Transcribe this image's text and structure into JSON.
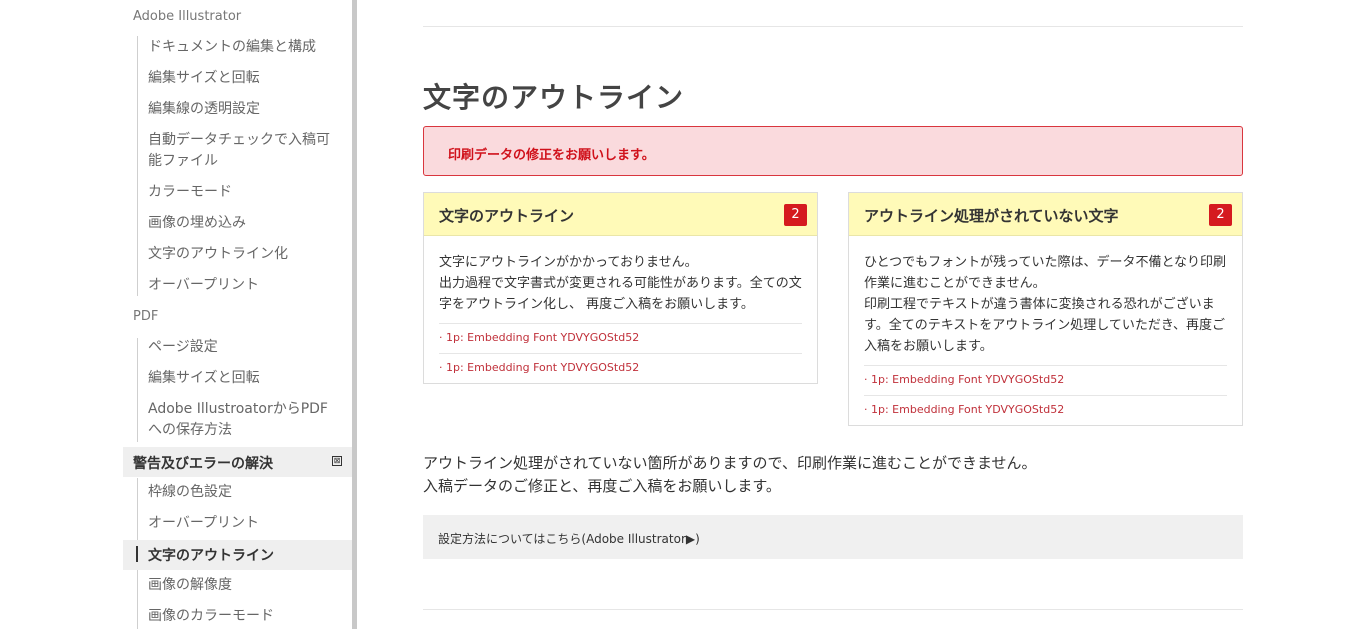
{
  "sidebar": {
    "sections": [
      {
        "label": "Adobe Illustrator",
        "items": [
          "ドキュメントの編集と構成",
          "編集サイズと回転",
          "編集線の透明設定",
          "自動データチェックで入稿可能ファイル",
          "カラーモード",
          "画像の埋め込み",
          "文字のアウトライン化",
          "オーバープリント"
        ]
      },
      {
        "label": "PDF",
        "items": [
          "ページ設定",
          "編集サイズと回転",
          "Adobe IllustroatorからPDFへの保存方法"
        ]
      },
      {
        "label": "警告及びエラーの解決",
        "toggle": "⊠",
        "items": [
          "枠線の色設定",
          "オーバープリント",
          "文字のアウトライン",
          "画像の解像度",
          "画像のカラーモード"
        ],
        "active_item": "文字のアウトライン"
      }
    ]
  },
  "main": {
    "title": "文字のアウトライン",
    "alert": "印刷データの修正をお願いします。",
    "cards": [
      {
        "title": "文字のアウトライン",
        "badge": "2",
        "description": "文字にアウトラインがかかっておりません。\n出力過程で文字書式が変更される可能性があります。全ての文字をアウトライン化し、 再度ご入稿をお願いします。",
        "items": [
          "· 1p: Embedding Font YDVYGOStd52",
          "· 1p: Embedding Font YDVYGOStd52"
        ]
      },
      {
        "title": "アウトライン処理がされていない文字",
        "badge": "2",
        "description": "ひとつでもフォントが残っていた際は、データ不備となり印刷作業に進むことができません。\n印刷工程でテキストが違う書体に変換される恐れがございます。全てのテキストをアウトライン処理していただき、再度ご入稿をお願いします。",
        "items": [
          "· 1p: Embedding Font YDVYGOStd52",
          "· 1p: Embedding Font YDVYGOStd52"
        ]
      }
    ],
    "summary": "アウトライン処理がされていない箇所がありますので、印刷作業に進むことができません。\n入稿データのご修正と、再度ご入稿をお願いします。",
    "howto_link": "設定方法についてはこちら(Adobe Illustrator▶)"
  },
  "colors": {
    "alert_bg": "#fadadd",
    "alert_border": "#d9363e",
    "alert_text": "#d0111b",
    "card_head_bg": "#fffab8",
    "badge_bg": "#d51a1f",
    "link_red": "#c0303a"
  }
}
